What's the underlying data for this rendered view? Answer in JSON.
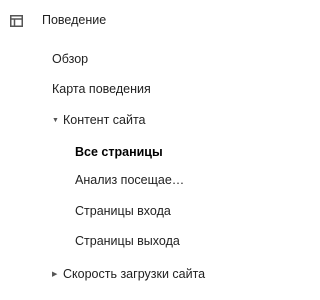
{
  "section": {
    "icon": "layout-icon",
    "label": "Поведение"
  },
  "items": [
    {
      "label": "Обзор"
    },
    {
      "label": "Карта поведения"
    },
    {
      "label": "Контент сайта",
      "expanded": true,
      "arrow": "▼",
      "children": [
        {
          "label": "Все страницы",
          "active": true
        },
        {
          "label": "Анализ посещае…"
        },
        {
          "label": "Страницы входа"
        },
        {
          "label": "Страницы выхода"
        }
      ]
    },
    {
      "label": "Скорость загрузки сайта",
      "expanded": false,
      "arrow": "▶"
    }
  ],
  "colors": {
    "text": "#212121",
    "active_text": "#000000",
    "icon": "#555555"
  }
}
